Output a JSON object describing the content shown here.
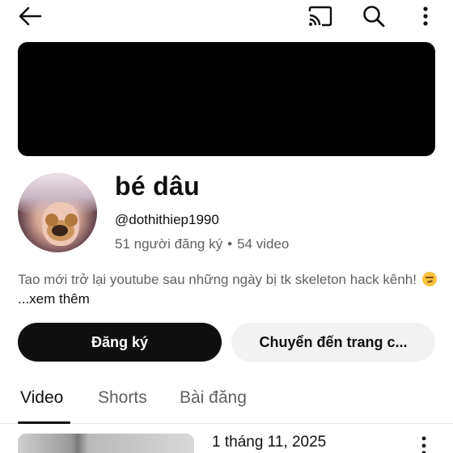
{
  "header": {
    "back_icon": "arrow-left-icon",
    "cast_icon": "cast-icon",
    "search_icon": "search-icon",
    "more_icon": "more-vertical-icon"
  },
  "channel": {
    "name": "bé dâu",
    "handle": "@dothithiep1990",
    "subscribers": "51 người đăng ký",
    "separator": "•",
    "video_count": "54 video",
    "description": "Tao mới trở lại youtube sau những ngày bị tk skeleton hack kênh!",
    "description_emoji": "smirk-emoji",
    "more_link": "...xem thêm"
  },
  "actions": {
    "subscribe_label": "Đăng ký",
    "goto_label": "Chuyển đến trang c..."
  },
  "tabs": [
    {
      "label": "Video",
      "active": true
    },
    {
      "label": "Shorts",
      "active": false
    },
    {
      "label": "Bài đăng",
      "active": false
    }
  ],
  "videos": [
    {
      "date": "1 tháng 11, 2025"
    }
  ],
  "colors": {
    "banner": "#000000",
    "primary_button": "#0f0f0f",
    "secondary_button": "#f2f2f2",
    "secondary_text": "#606060"
  }
}
